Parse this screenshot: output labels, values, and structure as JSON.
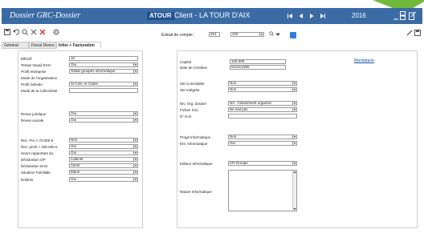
{
  "window": {
    "app_title": "Dossier GRC-Dossier",
    "badge": "ATOUR",
    "client": "Client - LA TOUR D'AIX",
    "year": "2016"
  },
  "colors": {
    "titlebar": "#3b6ba5",
    "badge": "#1f4f8f",
    "accent_triangle": "#6fb83a",
    "blue_button": "#2f7fd6",
    "link": "#1a4f9c"
  },
  "toolbar": {
    "extrait_label": "Extrait de compte :",
    "extrait_value": "201",
    "extrait_select": "220"
  },
  "tabs": [
    "Général",
    "Fiscal Divers",
    "Infos + Facturation"
  ],
  "left_panel": {
    "fields": [
      {
        "label": "Effectif",
        "value": "10",
        "kind": "input"
      },
      {
        "label": "Temps travail EXH",
        "value": "Oui",
        "kind": "select"
      },
      {
        "label": "Profil entreprise",
        "value": "Totale groupes informatique",
        "kind": "select"
      },
      {
        "label": "Mode de l'organisation",
        "value": "",
        "kind": "none"
      },
      {
        "label": "Profil individu",
        "value": "Si l'une, le Cadre",
        "kind": "select"
      },
      {
        "label": "Mode de la Collectivité",
        "value": "",
        "kind": "input"
      },
      {
        "label": "Revue juridique",
        "value": "Oui",
        "kind": "select"
      },
      {
        "label": "Revue sociale",
        "value": "Oui",
        "kind": "select"
      },
      {
        "label": "Rec. Pro > 70.000 €",
        "value": "Non",
        "kind": "select"
      },
      {
        "label": "Rec. privé > 200.000 €",
        "value": "Oui",
        "kind": "select"
      },
      {
        "label": "Heurs rapportant du...",
        "value": "Oui",
        "kind": "select"
      },
      {
        "label": "Déclaration OP",
        "value": "Cabinet",
        "kind": "select"
      },
      {
        "label": "Déclaration DAS",
        "value": "Client",
        "kind": "select"
      },
      {
        "label": "Situation Familiale",
        "value": "Marié",
        "kind": "select"
      },
      {
        "label": "Enfants",
        "value": "Oui",
        "kind": "select"
      }
    ]
  },
  "right_panel": {
    "fields": [
      {
        "label": "Capital",
        "value": "100.000",
        "kind": "input"
      },
      {
        "label": "Date de Création",
        "value": "01/01/1995",
        "kind": "input"
      },
      {
        "label": "Ste Consolidée",
        "value": "Non",
        "kind": "select"
      },
      {
        "label": "Ste Intégrée",
        "value": "Non",
        "kind": "select"
      },
      {
        "label": "Niv. Org. dossier",
        "value": "N3 - Classement organisé",
        "kind": "select"
      },
      {
        "label": "Fichier N.D.",
        "value": "Ne sait pas",
        "kind": "select"
      },
      {
        "label": "N° N.D.",
        "value": "",
        "kind": "input"
      },
      {
        "label": "Progit Informatique",
        "value": "Non",
        "kind": "select"
      },
      {
        "label": "Ent. Informatique",
        "value": "Oui",
        "kind": "select"
      },
      {
        "label": "Editeur Informatique",
        "value": "CR Groupe",
        "kind": "select"
      },
      {
        "label": "Nature Informatique",
        "value": "",
        "kind": "textarea"
      }
    ],
    "link": "Mandataire"
  }
}
